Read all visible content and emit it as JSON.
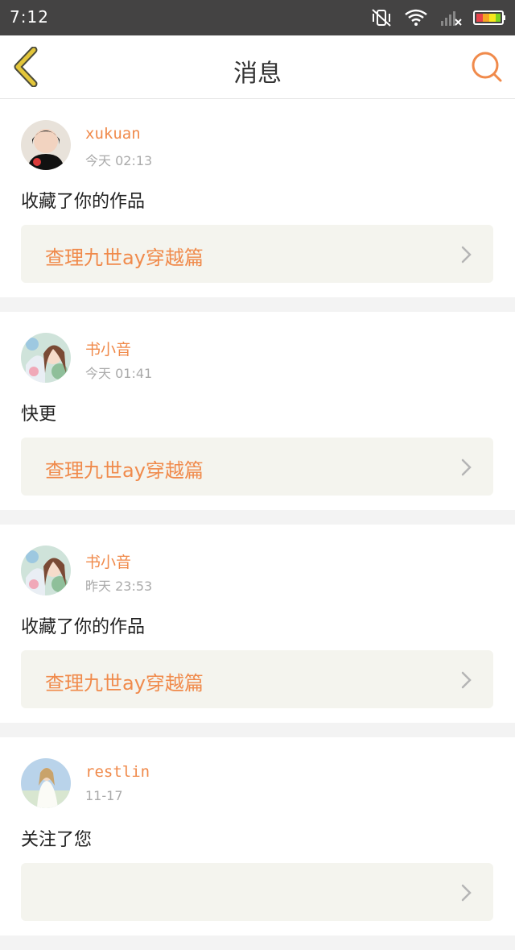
{
  "status_bar": {
    "time": "7:12",
    "icons": [
      "vibrate-off-icon",
      "wifi-icon",
      "signal-icon",
      "battery-icon"
    ]
  },
  "header": {
    "title": "消息",
    "back_icon": "chevron-left-icon",
    "search_icon": "search-icon"
  },
  "colors": {
    "accent": "#f08a4b",
    "back_icon": "#e3c63a",
    "card_link_bg": "#f4f4ee",
    "page_bg": "#f3f3f3",
    "status_bar_bg": "#444343"
  },
  "messages": [
    {
      "username": "xukuan",
      "time": "今天 02:13",
      "text": "收藏了你的作品",
      "work_title": "查理九世ay穿越篇",
      "avatar": "girl-avatar"
    },
    {
      "username": "书小音",
      "time": "今天 01:41",
      "text": "快更",
      "work_title": "查理九世ay穿越篇",
      "avatar": "anime-avatar"
    },
    {
      "username": "书小音",
      "time": "昨天 23:53",
      "text": "收藏了你的作品",
      "work_title": "查理九世ay穿越篇",
      "avatar": "anime-avatar"
    },
    {
      "username": "restlin",
      "time": "11-17",
      "text": "关注了您",
      "work_title": "",
      "avatar": "woman-avatar"
    }
  ]
}
